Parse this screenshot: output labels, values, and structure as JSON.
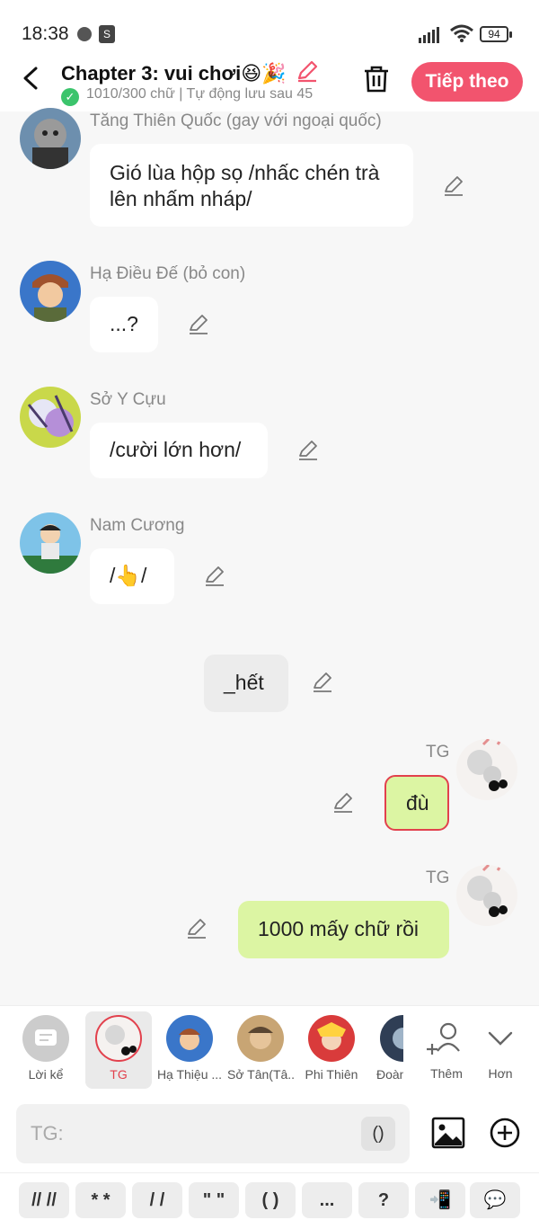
{
  "status": {
    "time": "18:38",
    "battery": "94"
  },
  "header": {
    "title": "Chapter 3: vui chơi",
    "title_emoji": "😆🎉",
    "subtitle": "1010/300 chữ | Tự động lưu sau 45",
    "next_button": "Tiếp theo"
  },
  "messages": [
    {
      "name": "Tăng Thiên Quốc (gay với ngoại quốc)",
      "text": "Gió lùa hộp sọ /nhấc chén trà lên nhấm nháp/"
    },
    {
      "name": "Hạ Điều Đế (bỏ con)",
      "text": "...?"
    },
    {
      "name": "Sở Y Cựu",
      "text": "/cười lớn hơn/"
    },
    {
      "name": "Nam Cương",
      "text": "/👆/"
    },
    {
      "name": "",
      "text": "_hết"
    },
    {
      "name": "TG",
      "text": "đù"
    },
    {
      "name": "TG",
      "text": "1000 mấy chữ rồi"
    }
  ],
  "characters": [
    {
      "label": "Lời kể"
    },
    {
      "label": "TG"
    },
    {
      "label": "Hạ Thiệu ..."
    },
    {
      "label": "Sở Tân(Tâ..."
    },
    {
      "label": "Phi Thiên"
    },
    {
      "label": "Đoàn"
    },
    {
      "label": "Thêm"
    },
    {
      "label": "Hơn"
    }
  ],
  "input": {
    "placeholder": "TG:",
    "paren": "()"
  },
  "format_buttons": [
    "// //",
    "* *",
    "/ /",
    "\" \"",
    "( )",
    "...",
    "?",
    "📲",
    "💬"
  ],
  "colors": {
    "accent": "#f2546e",
    "green_bubble": "#dcf5a3",
    "outline": "#e2414d"
  }
}
